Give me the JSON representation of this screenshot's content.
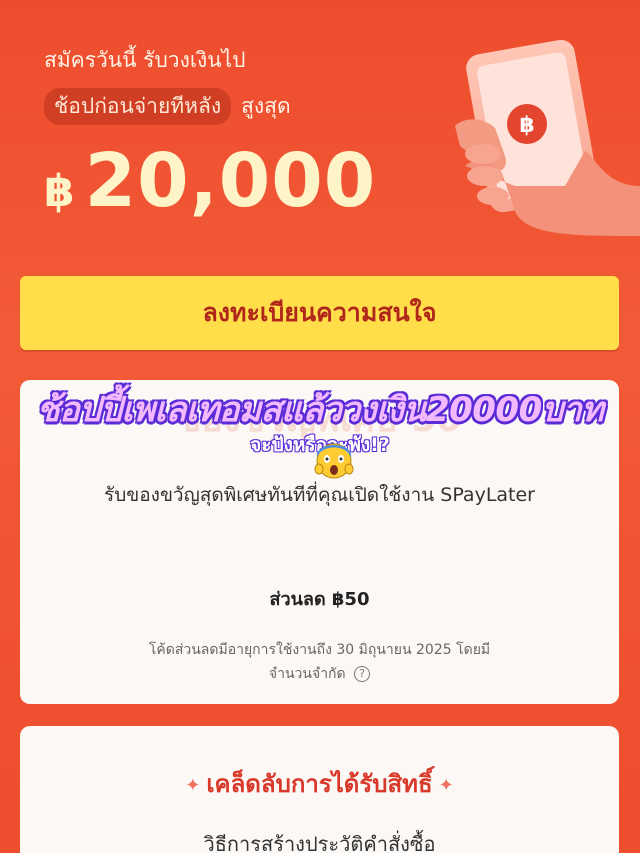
{
  "hero": {
    "line1": "สมัครวันนี้ รับวงเงินไป",
    "badge": "ช้อปก่อนจ่ายทีหลัง",
    "line2_suffix": "สูงสุด",
    "currency": "฿",
    "amount": "20,000",
    "illustration_icon": "baht-coin-icon"
  },
  "cta": {
    "label": "ลงทะเบียนความสนใจ"
  },
  "overlay": {
    "headline": "ช้อปปี้เพเลเทอมสแล้ววงเงิน20000บาท",
    "subline": "จะปังหรือจะพัง!?",
    "emoji_icon": "shocked-face-icon"
  },
  "card1": {
    "ghost_title": "ของขวัญพิเศษ 50",
    "subtitle": "รับของขวัญสุดพิเศษทันทีที่คุณเปิดใช้งาน SPayLater",
    "discount": "ส่วนลด ฿50",
    "note_line1": "โค้ดส่วนลดมีอายุการใช้งานถึง 30 มิถุนายน 2025 โดยมี",
    "note_line2": "จำนวนจำกัด",
    "info_icon": "?"
  },
  "card2": {
    "title": "เคล็ดลับการได้รับสิทธิ์",
    "subtitle": "วิธีการสร้างประวัติคำสั่งซื้อ"
  },
  "colors": {
    "background": "#ee4d2d",
    "cta_bg": "#ffde4a",
    "cta_text": "#b0261a",
    "amount": "#fff4c8",
    "overlay_text": "#f2b9ff",
    "overlay_outline": "#5a2bd6"
  }
}
